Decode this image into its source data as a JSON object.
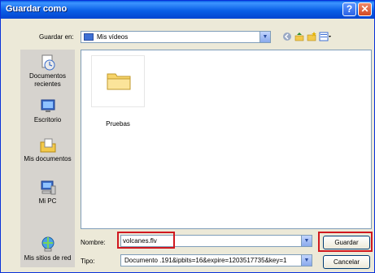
{
  "window": {
    "title": "Guardar como"
  },
  "titlebar": {
    "help_glyph": "?",
    "close_glyph": "✕"
  },
  "save_in": {
    "label": "Guardar en:",
    "value": "Mis vídeos",
    "icon": "folder-icon"
  },
  "toolbar": {
    "icons": [
      "back-icon",
      "up-folder-icon",
      "new-folder-icon",
      "view-menu-icon"
    ]
  },
  "places": [
    {
      "label": "Documentos recientes",
      "icon": "recent-documents-icon"
    },
    {
      "label": "Escritorio",
      "icon": "desktop-icon"
    },
    {
      "label": "Mis documentos",
      "icon": "my-documents-icon"
    },
    {
      "label": "Mi PC",
      "icon": "my-computer-icon"
    },
    {
      "label": "Mis sitios de red",
      "icon": "network-places-icon"
    }
  ],
  "files": [
    {
      "name": "Pruebas",
      "icon": "folder-icon"
    }
  ],
  "filename": {
    "label": "Nombre:",
    "value": "volcanes.flv"
  },
  "filetype": {
    "label": "Tipo:",
    "value": "Documento .191&ipbits=16&expire=1203517735&key=1"
  },
  "buttons": {
    "save": "Guardar",
    "cancel": "Cancelar"
  },
  "colors": {
    "titlebar": "#0a5fe6",
    "highlight": "#d0181f",
    "frame": "#ece9d8"
  }
}
